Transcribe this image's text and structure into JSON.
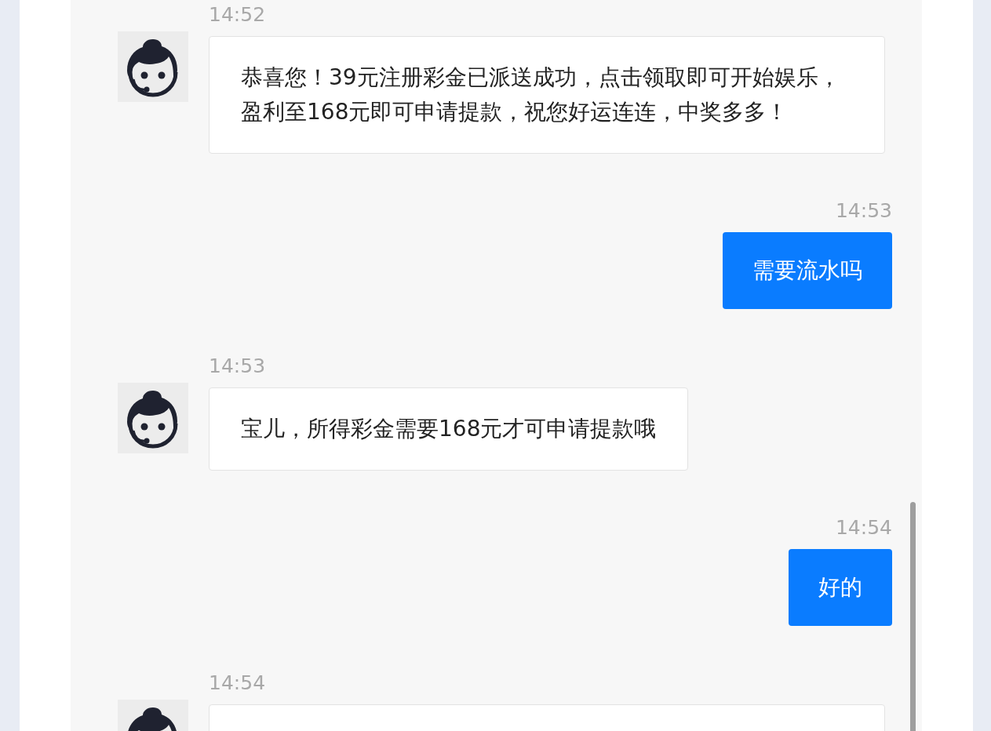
{
  "messages": [
    {
      "kind": "agent",
      "time": "14:52",
      "text": "恭喜您！39元注册彩金已派送成功，点击领取即可开始娱乐，盈利至168元即可申请提款，祝您好运连连，中奖多多！"
    },
    {
      "kind": "user",
      "time": "14:53",
      "text": "需要流水吗"
    },
    {
      "kind": "agent",
      "time": "14:53",
      "text": "宝儿，所得彩金需要168元才可申请提款哦"
    },
    {
      "kind": "user",
      "time": "14:54",
      "text": "好的"
    },
    {
      "kind": "agent",
      "time": "14:54"
    }
  ]
}
